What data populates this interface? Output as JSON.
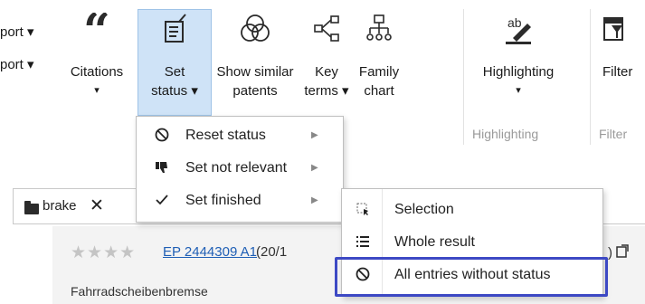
{
  "ribbon": {
    "left_cut": [
      "port ▾",
      "port ▾"
    ],
    "citations": {
      "line1": "Citations",
      "caret": "▾"
    },
    "set_status": {
      "line1": "Set",
      "line2": "status ▾"
    },
    "show_similar": {
      "line1": "Show similar",
      "line2": "patents"
    },
    "key_terms": {
      "line1": "Key",
      "line2": "terms ▾"
    },
    "family_chart": {
      "line1": "Family",
      "line2": "chart"
    },
    "highlighting": {
      "line1": "Highlighting",
      "caret": "▾"
    },
    "filter": {
      "line1": "Filter"
    },
    "group_labels": {
      "highlighting": "Highlighting",
      "filter": "Filter"
    }
  },
  "status_menu": {
    "items": [
      {
        "label": "Reset status",
        "icon": "reset-circle-icon",
        "arrow": "▶"
      },
      {
        "label": "Set not relevant",
        "icon": "thumbs-down-icon",
        "arrow": "▶"
      },
      {
        "label": "Set finished",
        "icon": "checkmark-icon",
        "arrow": "▶"
      }
    ]
  },
  "scope_submenu": {
    "items": [
      {
        "label": "Selection",
        "icon": "selection-icon"
      },
      {
        "label": "Whole result",
        "icon": "list-icon"
      },
      {
        "label": "All entries without status",
        "icon": "no-status-icon"
      }
    ],
    "highlight_color": "#3d49c4"
  },
  "doc_tab": {
    "label": "brake",
    "close": "✕"
  },
  "result": {
    "stars": "★★★★",
    "patent_link": "EP 2444309 A1",
    "date_prefix": "(20/1",
    "tail": ") ",
    "title": "Fahrradscheibenbremse"
  },
  "colors": {
    "active_button_bg": "#cfe3f7",
    "link": "#1f5fb5",
    "accent_border": "#3d49c4"
  }
}
